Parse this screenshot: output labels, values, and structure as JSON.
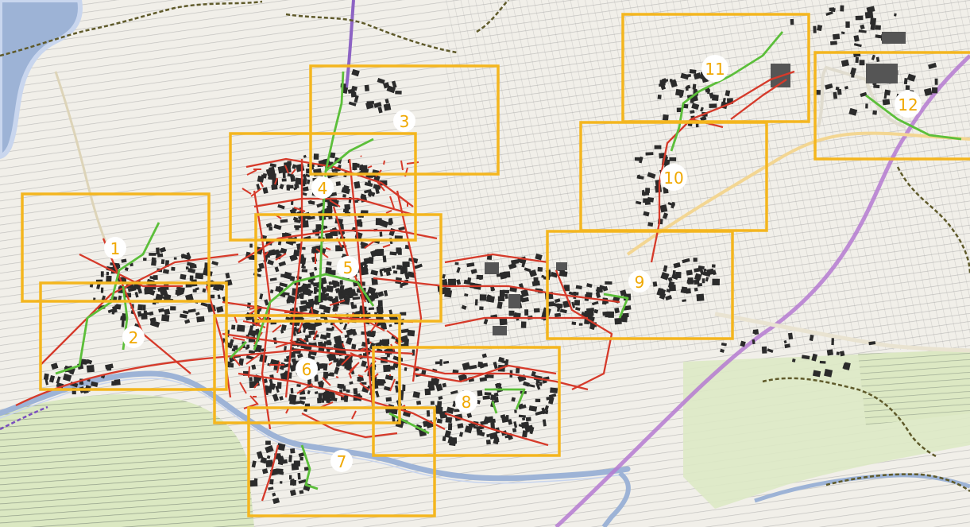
{
  "map": {
    "colors": {
      "background": "#f1efe9",
      "parcel_line": "#8c8c8c",
      "building": "#2b2b2b",
      "water": "#9db3d6",
      "river_edge": "#b9c9e6",
      "farmland": "#dde9c5",
      "boundary": "#5f5a2a",
      "network_red": "#d63a2a",
      "network_green": "#5cbf3a",
      "zone_orange": "#f4b61f",
      "railway": "#b57ad1",
      "main_road": "#f3d692"
    },
    "zones": [
      {
        "label": "1"
      },
      {
        "label": "2"
      },
      {
        "label": "3"
      },
      {
        "label": "4"
      },
      {
        "label": "5"
      },
      {
        "label": "6"
      },
      {
        "label": "7"
      },
      {
        "label": "8"
      },
      {
        "label": "9"
      },
      {
        "label": "10"
      },
      {
        "label": "11"
      },
      {
        "label": "12"
      }
    ]
  }
}
